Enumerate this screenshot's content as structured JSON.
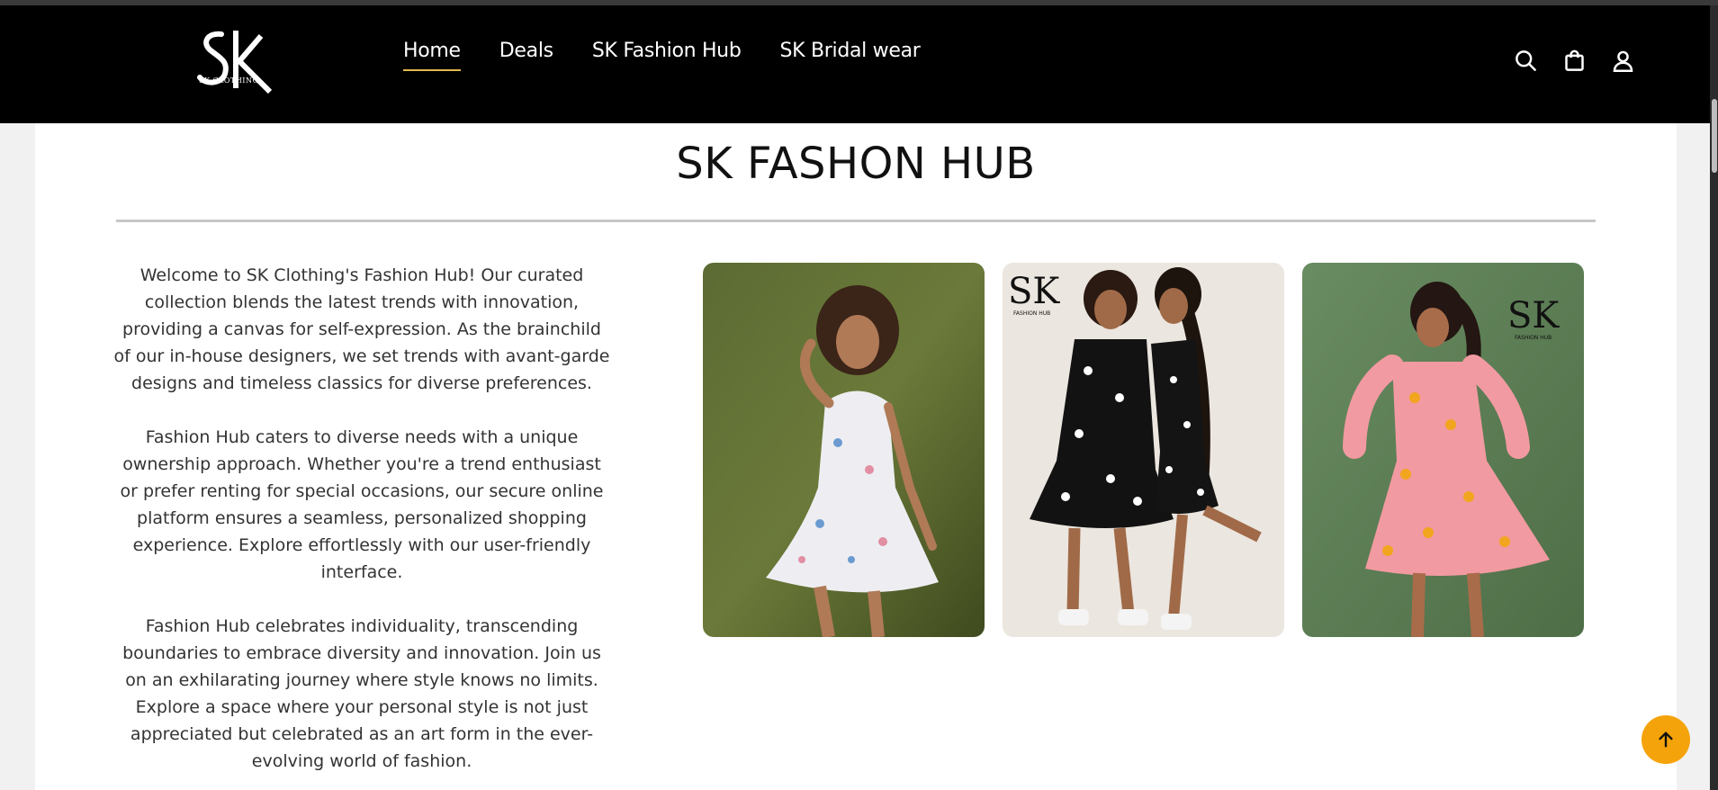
{
  "brand": {
    "logo_text": "SK",
    "logo_sub": "SK CLOTHING"
  },
  "nav": {
    "items": [
      {
        "label": "Home",
        "active": true
      },
      {
        "label": "Deals",
        "active": false
      },
      {
        "label": "SK Fashion Hub",
        "active": false
      },
      {
        "label": "SK Bridal wear",
        "active": false
      }
    ]
  },
  "header_icons": [
    "search-icon",
    "shopping-bag-icon",
    "user-icon"
  ],
  "main": {
    "title": "SK FASHON HUB",
    "paragraphs": [
      "Welcome to SK Clothing's Fashion Hub! Our curated collection blends the latest trends with innovation, providing a canvas for self-expression. As the brainchild of our in-house designers, we set trends with avant-garde designs and timeless classics for diverse preferences.",
      "Fashion Hub caters to diverse needs with a unique ownership approach. Whether you're a trend enthusiast or prefer renting for special occasions, our secure online platform ensures a seamless, personalized shopping experience. Explore effortlessly with our user-friendly interface.",
      "Fashion Hub celebrates individuality, transcending boundaries to embrace diversity and innovation. Join us on an exhilarating journey where style knows no limits. Explore a space where your personal style is not just appreciated but celebrated as an art form in the ever-evolving world of fashion."
    ],
    "photo_watermark": "SK",
    "photo_watermark_sub": "FASHION HUB"
  },
  "colors": {
    "header_bg": "#000000",
    "nav_active_underline": "#e2b84f",
    "scroll_top_button": "#f5a30a",
    "rule": "#c7c7c7"
  },
  "scroll_top_icon": "arrow-up-icon"
}
